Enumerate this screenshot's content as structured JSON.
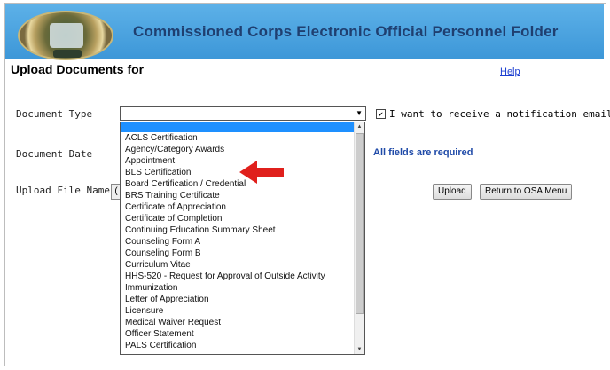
{
  "banner": {
    "title": "Commissioned Corps Electronic  Official Personnel Folder"
  },
  "page": {
    "heading": "Upload Documents for",
    "help_link": "Help"
  },
  "form": {
    "document_type_label": "Document Type",
    "document_date_label": "Document Date",
    "upload_file_label": "Upload File Name",
    "notification_label": "I want to receive a notification email",
    "notification_checked": true,
    "required_note": "All fields are required",
    "browse_stub": "(",
    "upload_button": "Upload",
    "return_button": "Return to OSA Menu"
  },
  "dropdown": {
    "selected": "",
    "options": [
      "ACLS Certification",
      "Agency/Category Awards",
      "Appointment",
      "BLS Certification",
      "Board Certification / Credential",
      "BRS Training Certificate",
      "Certificate of Appreciation",
      "Certificate of Completion",
      "Continuing Education Summary Sheet",
      "Counseling Form A",
      "Counseling Form B",
      "Curriculum Vitae",
      "HHS-520 - Request for Approval of Outside Activity",
      "Immunization",
      "Letter of Appreciation",
      "Licensure",
      "Medical Waiver Request",
      "Officer Statement",
      "PALS Certification"
    ]
  },
  "colors": {
    "banner": "#3d97d8",
    "highlight": "#1e90ff",
    "arrow": "#e0201c"
  }
}
